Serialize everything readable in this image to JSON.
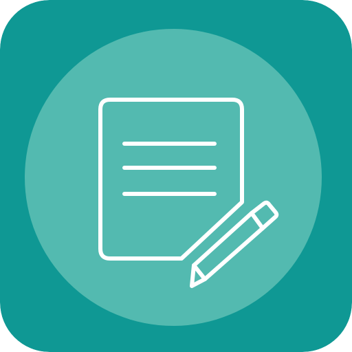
{
  "icon": {
    "name": "note-edit-icon",
    "depicts": [
      "document-icon",
      "pencil-icon"
    ],
    "colors": {
      "background": "#0F9894",
      "circle": "#53BAB0",
      "stroke": "#FFFFFF"
    }
  }
}
